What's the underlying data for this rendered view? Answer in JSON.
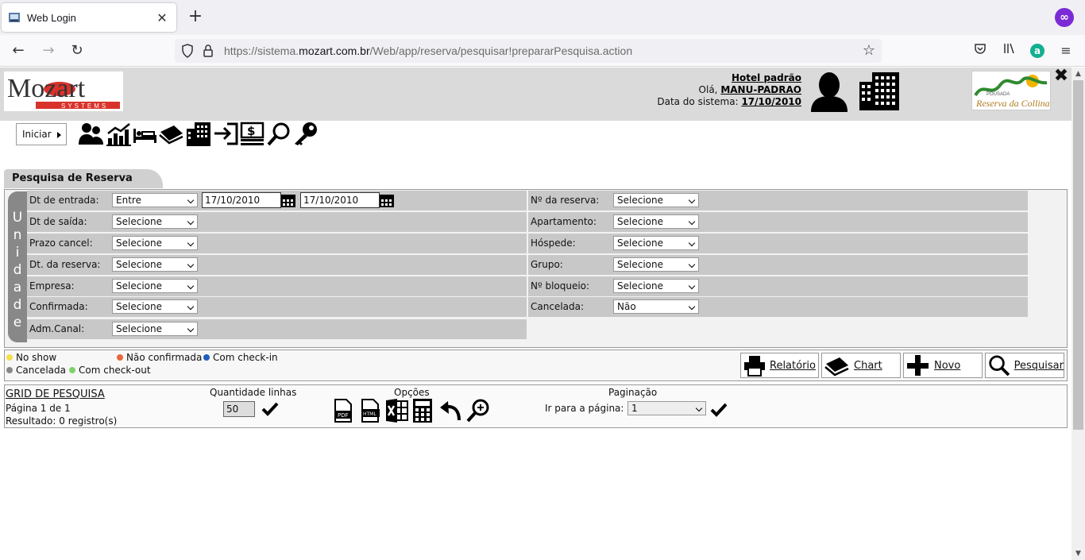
{
  "browser": {
    "tab_title": "Web Login",
    "url_prefix": "https://sistema.",
    "url_domain": "mozart.com.br",
    "url_path": "/Web/app/reserva/pesquisar!prepararPesquisa.action"
  },
  "header": {
    "logo_text": "Mozart",
    "logo_sub": "SYSTEMS",
    "hotel_name": "Hotel padrão",
    "greeting": "Olá,",
    "user": "MANU-PADRAO",
    "date_label": "Data do sistema:",
    "date": "17/10/2010",
    "hotel_logo_top": "POUSADA",
    "hotel_logo_text": "Reserva da Collina"
  },
  "menu": {
    "start_label": "Iniciar"
  },
  "section_title": "Pesquisa de Reserva",
  "unit_label": [
    "U",
    "n",
    "i",
    "d",
    "a",
    "d",
    "e"
  ],
  "filters_left": [
    {
      "label": "Dt de entrada:",
      "value": "Entre",
      "date_from": "17/10/2010",
      "date_to": "17/10/2010"
    },
    {
      "label": "Dt de saída:",
      "value": "Selecione"
    },
    {
      "label": "Prazo cancel:",
      "value": "Selecione"
    },
    {
      "label": "Dt. da reserva:",
      "value": "Selecione"
    },
    {
      "label": "Empresa:",
      "value": "Selecione"
    },
    {
      "label": "Confirmada:",
      "value": "Selecione"
    },
    {
      "label": "Adm.Canal:",
      "value": "Selecione"
    }
  ],
  "filters_right": [
    {
      "label": "Nº da reserva:",
      "value": "Selecione"
    },
    {
      "label": "Apartamento:",
      "value": "Selecione"
    },
    {
      "label": "Hóspede:",
      "value": "Selecione"
    },
    {
      "label": "Grupo:",
      "value": "Selecione"
    },
    {
      "label": "Nº bloqueio:",
      "value": "Selecione"
    },
    {
      "label": "Cancelada:",
      "value": "Não"
    }
  ],
  "legend": {
    "no_show": "No show",
    "nao_confirmada": "Não confirmada",
    "com_checkin": "Com check-in",
    "cancelada": "Cancelada",
    "com_checkout": "Com check-out"
  },
  "actions": {
    "relatorio": "Relatório",
    "chart": "Chart",
    "novo": "Novo",
    "pesquisar": "Pesquisar"
  },
  "grid": {
    "title": "GRID DE PESQUISA",
    "page_info": "Página 1 de 1",
    "result": "Resultado: 0 registro(s)",
    "qty_label": "Quantidade linhas",
    "qty_value": "50",
    "options_label": "Opções",
    "pagination_label": "Paginação",
    "goto_label": "Ir para a página:",
    "page_value": "1"
  },
  "colors": {
    "no_show": "#f4e04a",
    "nao_confirmada": "#e8663c",
    "com_checkin": "#1f5fbf",
    "cancelada": "#888888",
    "com_checkout": "#7ed36a"
  }
}
